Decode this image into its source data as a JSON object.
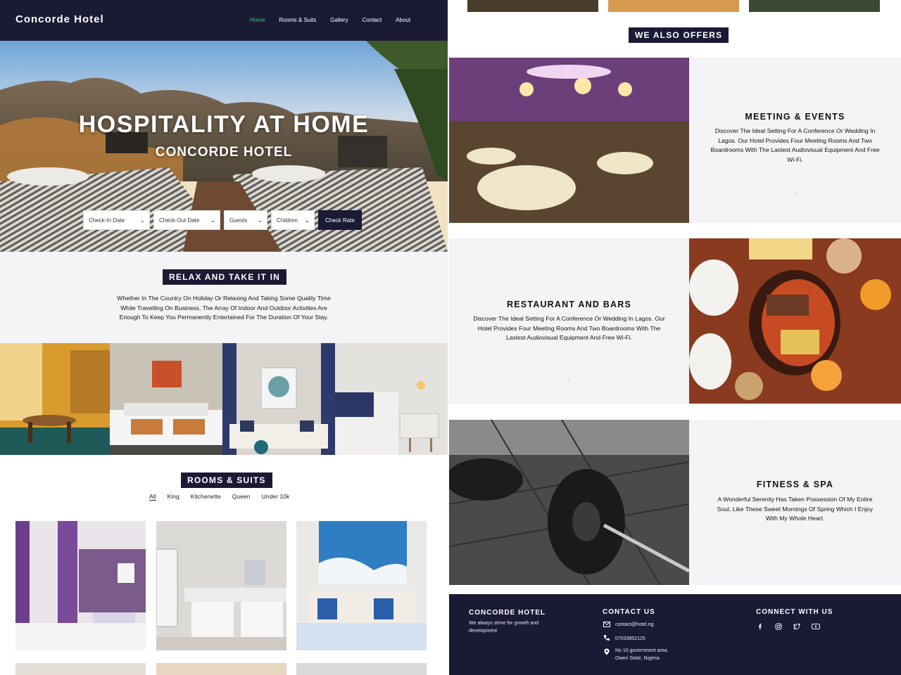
{
  "nav": {
    "brand": "Concorde Hotel",
    "links": [
      "Home",
      "Rooms & Suits",
      "Gallery",
      "Contact",
      "About"
    ],
    "active": "Home"
  },
  "hero": {
    "title": "HOSPITALITY AT HOME",
    "subtitle": "CONCORDE HOTEL",
    "booking": {
      "checkin_label": "Check-In Date",
      "checkout_label": "Check-Out Date",
      "guests_label": "Guests",
      "children_label": "Children",
      "button_label": "Check Rate"
    }
  },
  "relax": {
    "tag": "RELAX AND TAKE IT IN",
    "text": "Whether In The Country On Holiday Or Relaxing And Taking Some Quality Time While Travelling On Business, The Array Of Indoor And Outdoor Activities Are Enough To Keep You Permanently Entertained For The Duration Of Your Stay."
  },
  "rooms": {
    "tag": "ROOMS & SUITS",
    "filters": [
      "All",
      "King",
      "Kitchenette",
      "Queen",
      "Under 10k"
    ],
    "active_filter": "All"
  },
  "offers": {
    "tag": "WE ALSO OFFERS",
    "items": [
      {
        "title": "MEETING & EVENTS",
        "text": "Discover The Ideal Setting For A Conference Or Wedding In Lagos. Our Hotel Provides Four Meeting Rooms And Two Boardrooms With The Lastest Audiovisual Equipment And Free Wi-Fi.",
        "dot": "."
      },
      {
        "title": "RESTAURANT AND BARS",
        "text": "Discover The Ideal Setting For A Conference Or Wedding In Lagos. Our Hotel Provides Four Meeting Rooms And Two Boardrooms With The Lastest Audiovisual Equipment And Free Wi-Fi.",
        "dot": "."
      },
      {
        "title": "FITNESS & SPA",
        "text": "A Wonderful Serenity Has Taken Possession Of My Entire Soul, Like These Sweet Mornings Of Spring Which I Enjoy With My Whole Heart."
      }
    ]
  },
  "footer": {
    "brand": "CONCORDE HOTEL",
    "tagline": "We always strive for growth and development",
    "contact_heading": "CONTACT US",
    "email": "contact@hotel.ng",
    "phone": "07033852125",
    "address_line1": "No 10 government area,",
    "address_line2": "Oweri State, Nigeria.",
    "connect_heading": "CONNECT WITH US",
    "social_icons": [
      "facebook-icon",
      "instagram-icon",
      "twitter-icon",
      "youtube-icon"
    ]
  },
  "colors": {
    "navy": "#1b1a35",
    "active_link": "#2ecc71",
    "panel_bg": "#f4f3f6"
  }
}
